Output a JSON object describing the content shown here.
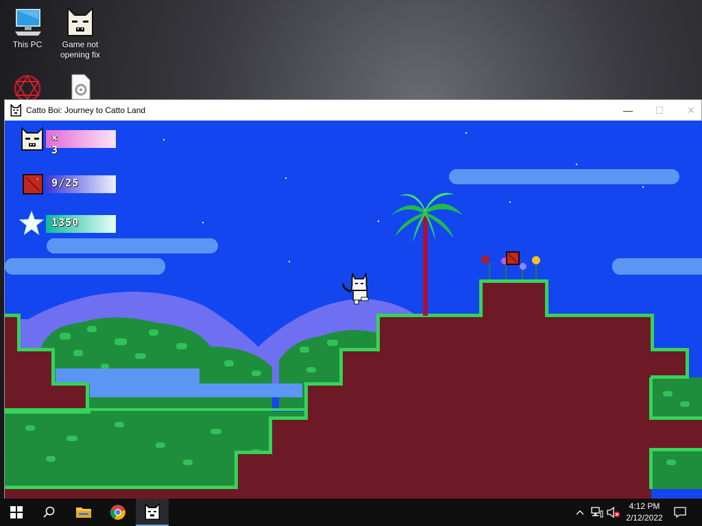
{
  "desktop": {
    "icons": [
      {
        "label": "This PC",
        "icon": "computer-icon"
      },
      {
        "label": "Game not opening fix",
        "icon": "cat-face-icon"
      },
      {
        "label": "",
        "icon": "red-pattern-icon"
      },
      {
        "label": "",
        "icon": "settings-file-icon"
      }
    ]
  },
  "window": {
    "title": "Catto Boi: Journey to Catto Land",
    "minimize_glyph": "—",
    "maximize_glyph": "☐",
    "close_glyph": "✕"
  },
  "hud": {
    "lives": "× 3",
    "crates": "9/25",
    "score": "1350"
  },
  "taskbar": {
    "apps": [
      "start-icon",
      "search-icon",
      "file-explorer-icon",
      "chrome-icon",
      "catto-boi-app-icon"
    ],
    "tray": [
      "chevron-up-icon",
      "network-icon",
      "volume-muted-icon",
      "notification-icon"
    ],
    "time": "4:12 PM",
    "date": "2/12/2022"
  },
  "colors": {
    "sky": "#1446f0",
    "cloud": "#5b96f5",
    "hill": "#6f6ff2",
    "dirt": "#6e1a26",
    "grass": "#35d35a",
    "bush": "#1f8e3c",
    "bush_light": "#2ec358"
  }
}
